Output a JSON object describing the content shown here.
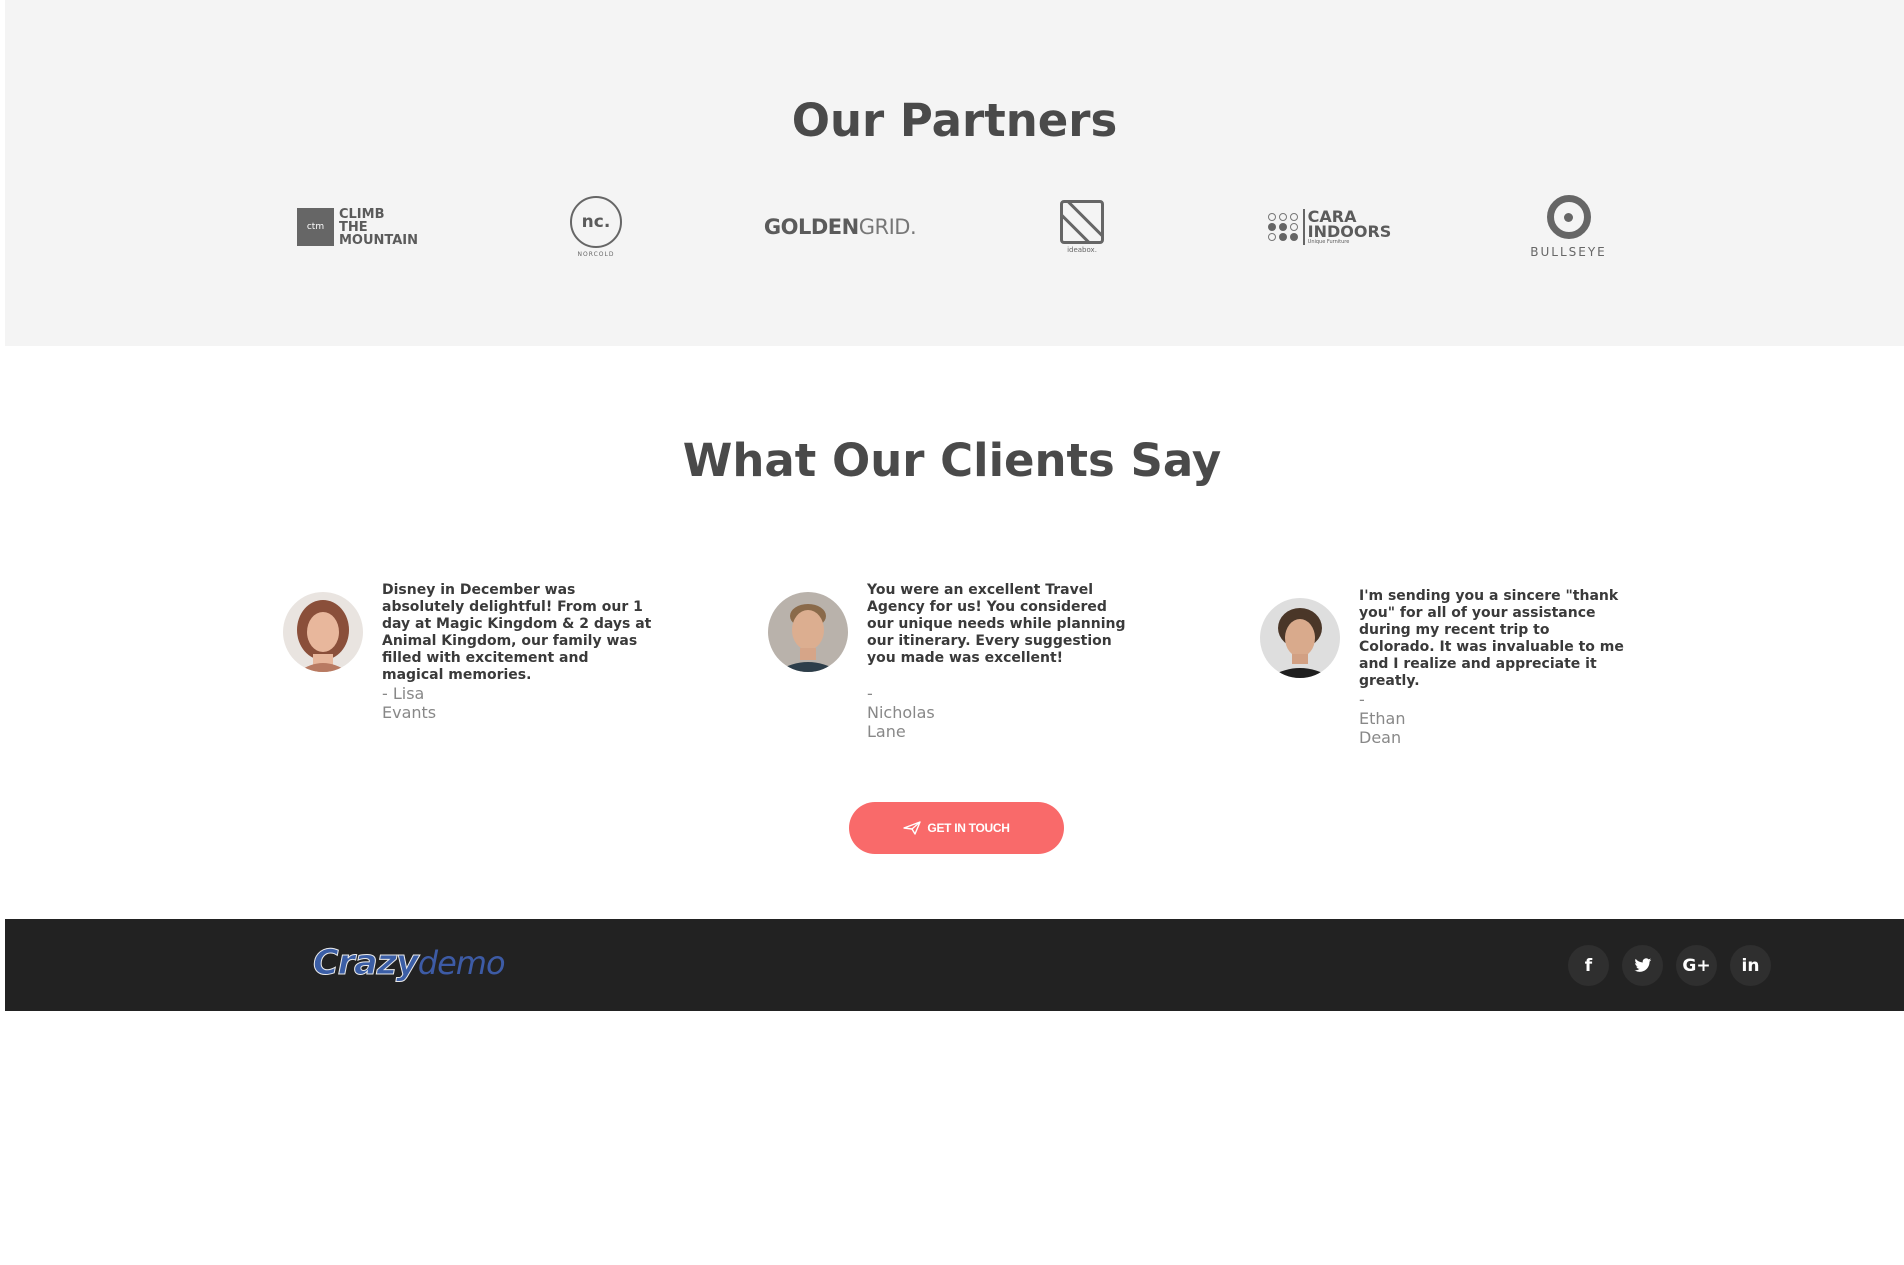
{
  "partners": {
    "title": "Our Partners",
    "logos": [
      {
        "name": "climb-the-mountain",
        "badge": "ctm",
        "lines": [
          "CLIMB",
          "THE",
          "MOUNTAIN"
        ]
      },
      {
        "name": "norcold",
        "mark": "nc.",
        "sub": "NORCOLD"
      },
      {
        "name": "goldengrid",
        "bold": "GOLDEN",
        "light": "GRID."
      },
      {
        "name": "ideabox",
        "sub": "ideabox."
      },
      {
        "name": "cara-indoors",
        "lines": [
          "CARA",
          "INDOORS"
        ],
        "sub": "Unique Furniture"
      },
      {
        "name": "bullseye",
        "sub": "BULLSEYE"
      }
    ]
  },
  "clients": {
    "title": "What Our Clients Say",
    "testimonials": [
      {
        "quote": "Disney in December was absolutely delightful! From our 1 day at Magic Kingdom & 2 days at Animal Kingdom, our family was filled with excitement and magical memories.",
        "author": "- Lisa Evants"
      },
      {
        "quote": "You were an excellent Travel Agency for us! You considered our unique needs while planning our itinerary. Every suggestion you made was excellent!",
        "author": "- Nicholas Lane"
      },
      {
        "quote": "I'm sending you a sincere \"thank you\" for all of your assistance during my recent trip to Colorado. It was invaluable to me and I realize and appreciate it greatly.",
        "author": "- Ethan Dean"
      }
    ]
  },
  "cta": {
    "label": "GET IN TOUCH",
    "icon": "paper-plane-icon",
    "color": "#f96a6a"
  },
  "footer": {
    "brand_crazy": "Crazy",
    "brand_demo": "demo",
    "social": [
      {
        "name": "facebook-icon",
        "glyph": "f"
      },
      {
        "name": "twitter-icon",
        "glyph": "t"
      },
      {
        "name": "google-plus-icon",
        "glyph": "G+"
      },
      {
        "name": "linkedin-icon",
        "glyph": "in"
      }
    ]
  }
}
